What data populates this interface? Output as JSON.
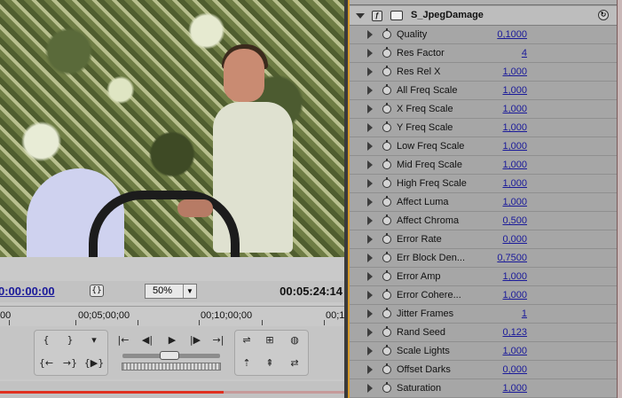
{
  "monitor": {
    "current_timecode": "0:00:00:00",
    "duration_timecode": "00:05:24:14",
    "zoom": "50%",
    "ruler_labels": [
      "00",
      "00;05;00;00",
      "00;10;00;00",
      "00;1"
    ]
  },
  "effect": {
    "name": "S_JpegDamage",
    "params": [
      {
        "label": "Quality",
        "value": "0,1000"
      },
      {
        "label": "Res Factor",
        "value": "4"
      },
      {
        "label": "Res Rel X",
        "value": "1,000"
      },
      {
        "label": "All Freq Scale",
        "value": "1,000"
      },
      {
        "label": "X Freq Scale",
        "value": "1,000"
      },
      {
        "label": "Y Freq Scale",
        "value": "1,000"
      },
      {
        "label": "Low Freq Scale",
        "value": "1,000"
      },
      {
        "label": "Mid Freq Scale",
        "value": "1,000"
      },
      {
        "label": "High Freq Scale",
        "value": "1,000"
      },
      {
        "label": "Affect Luma",
        "value": "1,000"
      },
      {
        "label": "Affect Chroma",
        "value": "0,500"
      },
      {
        "label": "Error Rate",
        "value": "0,000"
      },
      {
        "label": "Err Block Den...",
        "value": "0,7500"
      },
      {
        "label": "Error Amp",
        "value": "1,000"
      },
      {
        "label": "Error Cohere...",
        "value": "1,000"
      },
      {
        "label": "Jitter Frames",
        "value": "1"
      },
      {
        "label": "Rand Seed",
        "value": "0,123"
      },
      {
        "label": "Scale Lights",
        "value": "1,000"
      },
      {
        "label": "Offset Darks",
        "value": "0,000"
      },
      {
        "label": "Saturation",
        "value": "1,000"
      }
    ]
  },
  "colors": {
    "timecode_blue": "#1a1a9a",
    "panel_gray": "#a6a6a6",
    "accent_orange": "#d79a2a",
    "playhead_red": "#e03020"
  }
}
